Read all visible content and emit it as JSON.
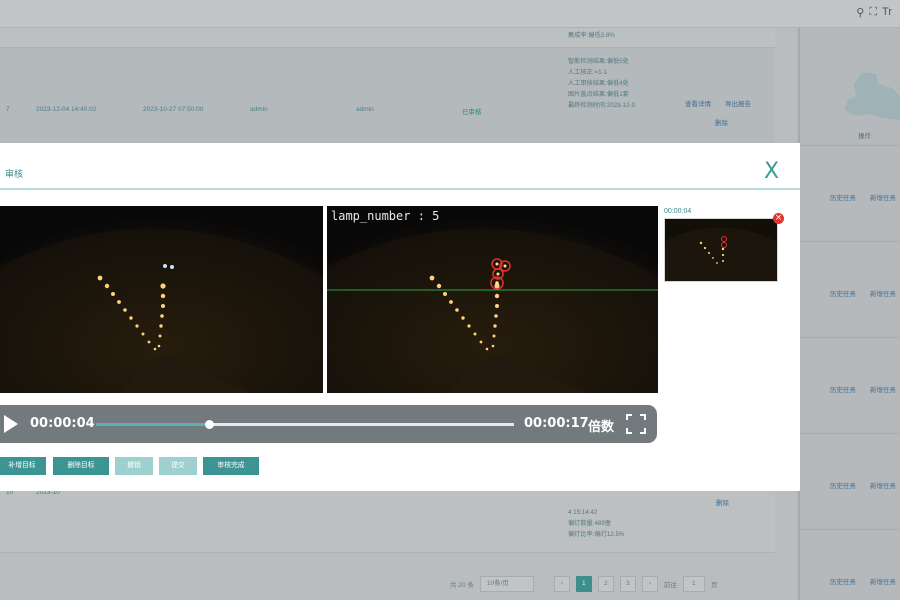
{
  "header": {
    "icons": [
      "search-icon",
      "fullscreen-icon",
      "font-size-icon"
    ],
    "font_label": "Tr"
  },
  "table": {
    "top_fragment": "集成率:偏低3.8%",
    "row7": {
      "index": "7",
      "time1": "2023-12-04 14:40:02",
      "time2": "2023-10-27 07:50:00",
      "user1": "admin",
      "user2": "admin",
      "status": "已审核",
      "info": [
        "智能检测结果:偏低5处",
        "人工核正:=1-1",
        "人工审核结果:偏低4处",
        "图片盖点结果:偏低1套",
        "最终检测时间:2023-12-0"
      ],
      "link_detail": "查看详情",
      "link_export": "导出报告",
      "link_delete": "删除"
    },
    "row_bottom": {
      "index": "10",
      "time": "2023-10",
      "info": [
        "4 15:14:42",
        "偏灯数量:489盏",
        "偏灯比率:偏灯12.5%"
      ],
      "link_delete": "删除"
    },
    "side": {
      "col_header": "操作",
      "row_links": [
        [
          "历史任务",
          "新增任务"
        ],
        [
          "历史任务",
          "新增任务"
        ],
        [
          "历史任务",
          "新增任务"
        ],
        [
          "历史任务",
          "新增任务"
        ],
        [
          "历史任务",
          "新增任务"
        ]
      ]
    }
  },
  "pager": {
    "total": "共 20 条",
    "page_size": "10条/页",
    "pages": [
      "1",
      "2",
      "3"
    ],
    "current": "1",
    "goto_label": "前往",
    "goto_value": "1",
    "goto_suffix": "页"
  },
  "modal": {
    "title": "审核",
    "close_label": "X",
    "overlay_text": "lamp_number : 5",
    "thumbnail_time": "00:00:04",
    "player": {
      "current_time": "00:00:04",
      "total_time": "00:00:17",
      "speed_label": "倍数",
      "progress": 0.27
    },
    "buttons": {
      "add_target": "补增目标",
      "delete_target": "删除目标",
      "undo": "撤销",
      "submit": "提交",
      "finish": "审核完成"
    }
  },
  "colors": {
    "accent": "#3d9593",
    "accent_light": "#9dd0ce",
    "marker": "#e4322b",
    "control_bar": "#737a7d"
  }
}
